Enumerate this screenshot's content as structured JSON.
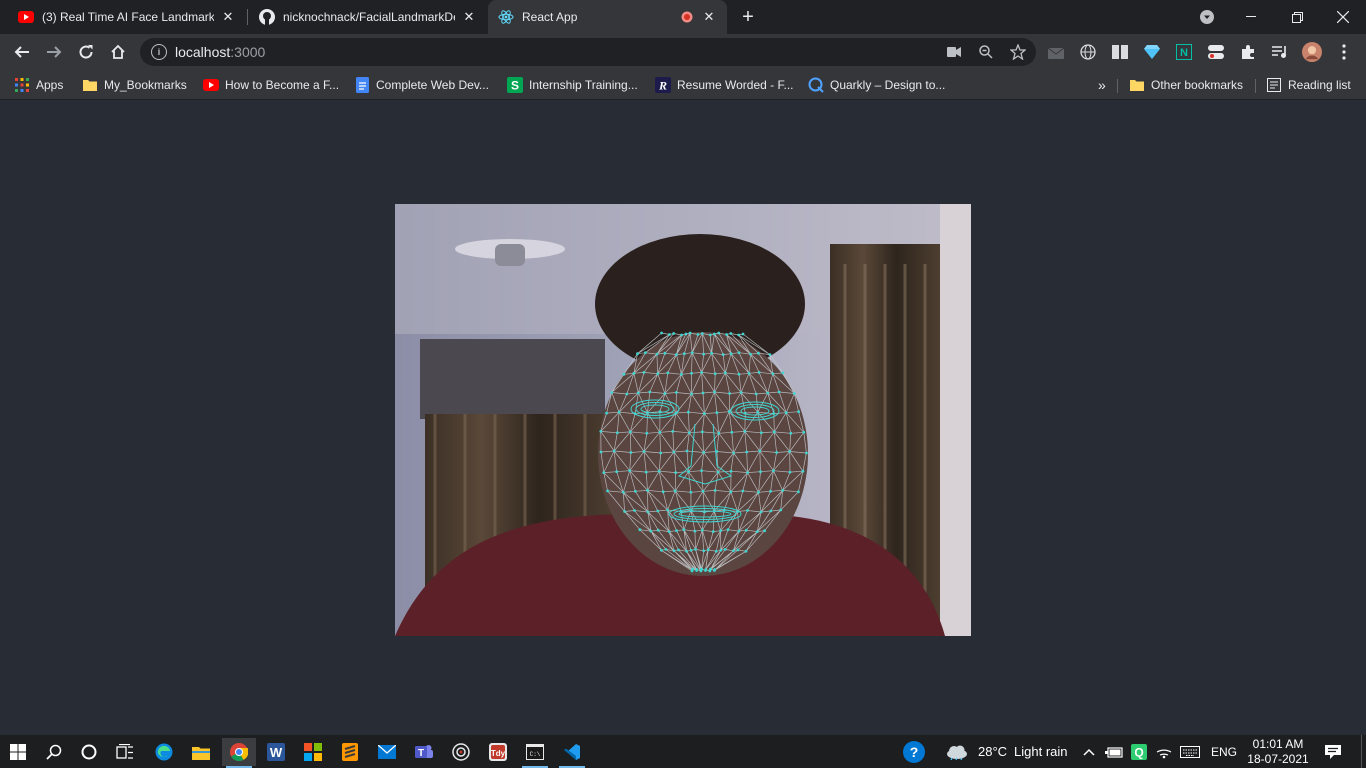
{
  "browser": {
    "tabs": [
      {
        "title": "(3) Real Time AI Face Landmark D",
        "icon": "youtube-icon",
        "active": false
      },
      {
        "title": "nicknochnack/FacialLandmarkDe",
        "icon": "github-icon",
        "active": false
      },
      {
        "title": "React App",
        "icon": "react-icon",
        "active": true
      }
    ],
    "address": {
      "host": "localhost",
      "port": ":3000"
    },
    "bookmarks": [
      {
        "label": "Apps",
        "icon": "apps-grid-icon"
      },
      {
        "label": "My_Bookmarks",
        "icon": "folder-icon"
      },
      {
        "label": "How to Become a F...",
        "icon": "youtube-icon"
      },
      {
        "label": "Complete Web Dev...",
        "icon": "docs-icon"
      },
      {
        "label": "Internship Training...",
        "icon": "s-logo-icon"
      },
      {
        "label": "Resume Worded - F...",
        "icon": "r-logo-icon"
      },
      {
        "label": "Quarkly – Design to...",
        "icon": "q-logo-icon"
      }
    ],
    "bookmarks_right": {
      "more": "»",
      "other": "Other bookmarks",
      "reading": "Reading list"
    }
  },
  "taskbar": {
    "weather": {
      "temp": "28°C",
      "desc": "Light rain"
    },
    "lang": "ENG",
    "time": "01:01 AM",
    "date": "18-07-2021"
  },
  "colors": {
    "mesh": "#3fd5d0",
    "page_bg": "#282c34"
  }
}
